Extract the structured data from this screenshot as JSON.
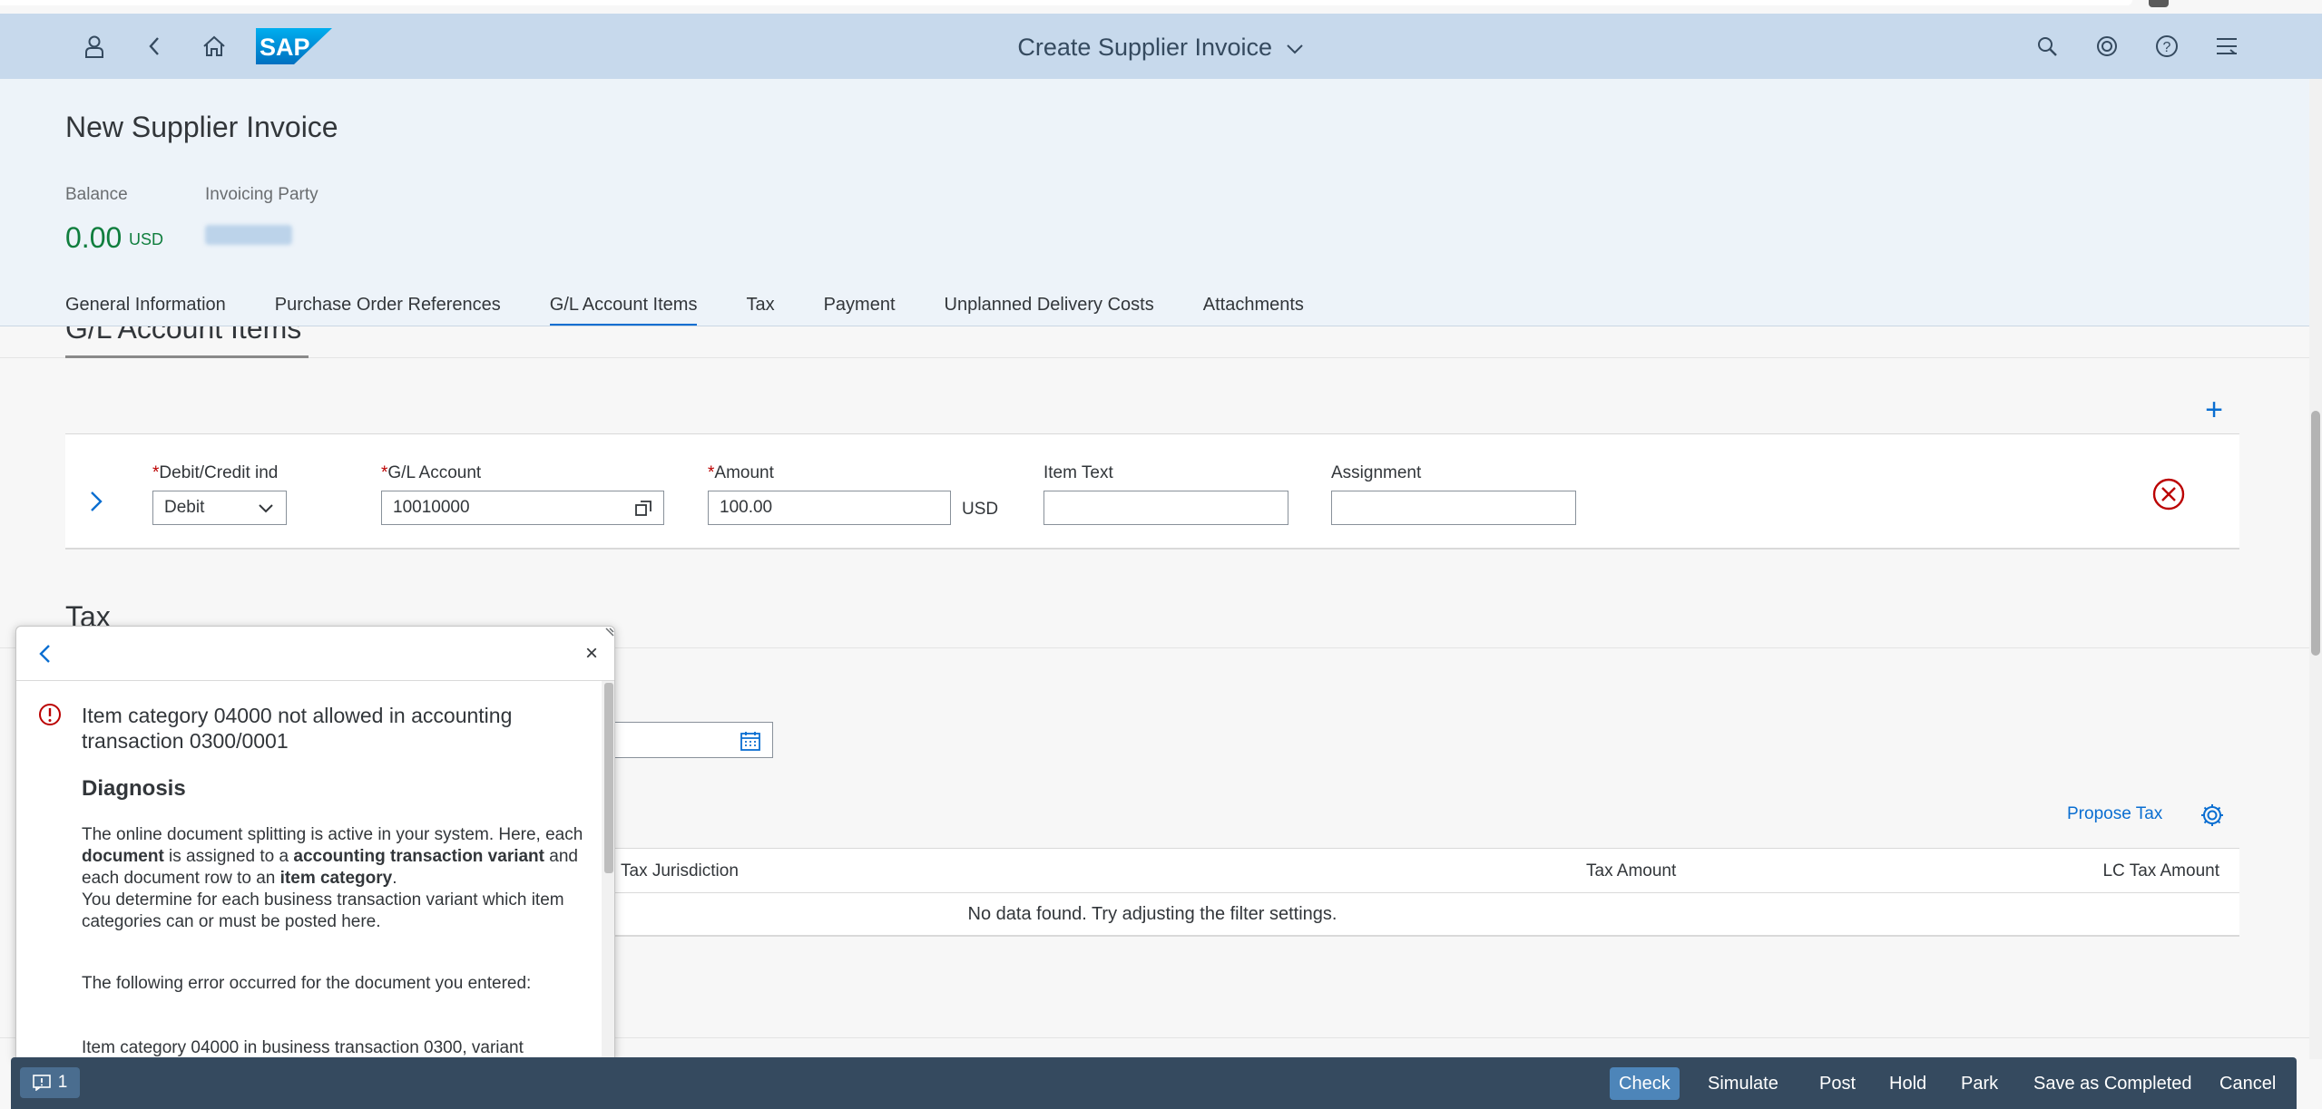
{
  "shell": {
    "title": "Create Supplier Invoice",
    "icons": [
      "user-icon",
      "back-icon",
      "home-icon",
      "search-icon",
      "copilot-icon",
      "help-icon",
      "menu-icon"
    ]
  },
  "header": {
    "title": "New Supplier Invoice",
    "balance_label": "Balance",
    "balance_value": "0.00",
    "balance_currency": "USD",
    "invoicing_party_label": "Invoicing Party",
    "tabs": [
      {
        "label": "General Information"
      },
      {
        "label": "Purchase Order References"
      },
      {
        "label": "G/L Account Items",
        "active": true
      },
      {
        "label": "Tax"
      },
      {
        "label": "Payment"
      },
      {
        "label": "Unplanned Delivery Costs"
      },
      {
        "label": "Attachments"
      }
    ]
  },
  "gl_section": {
    "title": "G/L Account Items",
    "row": {
      "debit_credit_label": "Debit/Credit ind",
      "debit_credit_value": "Debit",
      "gl_account_label": "G/L Account",
      "gl_account_value": "10010000",
      "amount_label": "Amount",
      "amount_value": "100.00",
      "amount_unit": "USD",
      "item_text_label": "Item Text",
      "item_text_value": "",
      "assignment_label": "Assignment",
      "assignment_value": "",
      "required_mark": "*"
    }
  },
  "tax_section": {
    "title": "Tax",
    "propose_tax": "Propose Tax",
    "columns": [
      "Tax Jurisdiction",
      "Tax Amount",
      "LC Tax Amount"
    ],
    "empty_text": "No data found. Try adjusting the filter settings."
  },
  "popover": {
    "message_title": "Item category 04000 not allowed in accounting transaction 0300/0001",
    "diagnosis_heading": "Diagnosis",
    "para1_parts": [
      "The online document splitting is active in your system. Here, each ",
      "document",
      " is assigned to a ",
      "accounting transaction variant",
      " and each document row to an ",
      "item category",
      "."
    ],
    "para1b": "You determine for each business transaction variant which item categories can or must be posted here.",
    "para2": "The following error occurred for the document you entered:",
    "para3": "Item category 04000 in business transaction 0300, variant"
  },
  "footer": {
    "message_count": "1",
    "buttons": [
      "Check",
      "Simulate",
      "Post",
      "Hold",
      "Park",
      "Save as Completed",
      "Cancel"
    ]
  },
  "colors": {
    "shell_bg": "#c7d9ec",
    "header_bg": "#edf3f9",
    "footer_bg": "#354a5f",
    "accent": "#0a6ed1",
    "positive": "#107e3e",
    "negative": "#bb0000"
  }
}
